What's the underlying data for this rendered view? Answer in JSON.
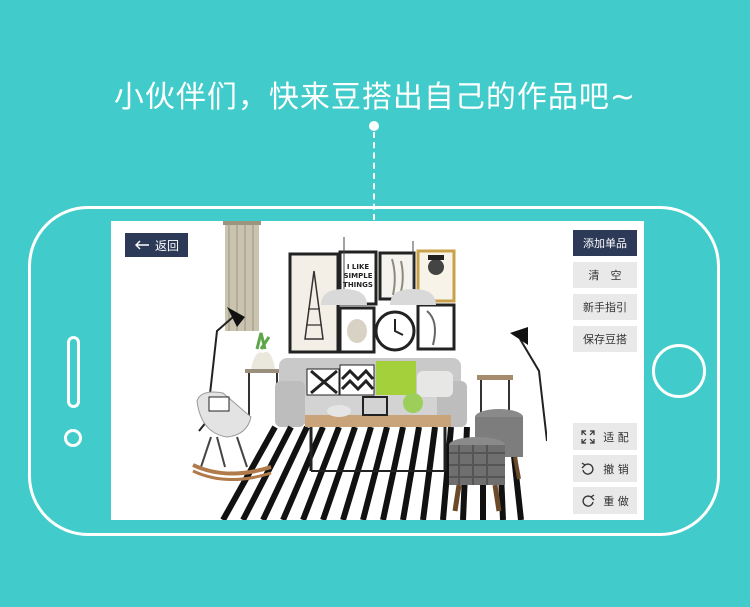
{
  "headline": "小伙伴们，快来豆搭出自己的作品吧~",
  "toolbar": {
    "back_label": "返回",
    "add_item_label": "添加单品",
    "clear_label": "清　空",
    "guide_label": "新手指引",
    "save_label": "保存豆搭"
  },
  "tools": {
    "fit_label": "适 配",
    "undo_label": "撤 销",
    "redo_label": "重 做"
  },
  "artwork": {
    "poster_text": [
      "I LIKE",
      "SIMPLE",
      "THINGS"
    ]
  },
  "colors": {
    "background": "#41cccb",
    "button_dark": "#2c3a57",
    "button_light": "#e9e9e9"
  },
  "icons": [
    "back-arrow-icon",
    "fit-icon",
    "undo-icon",
    "redo-icon"
  ]
}
